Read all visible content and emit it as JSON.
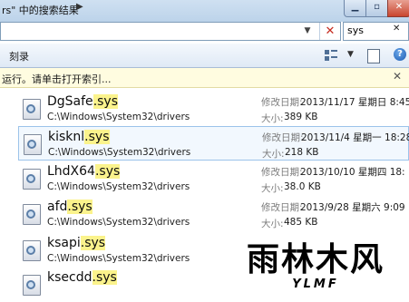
{
  "address": {
    "path_text": "rs\" 中的搜索结果"
  },
  "search": {
    "value": "sys"
  },
  "toolbar": {
    "record_label": "刻录"
  },
  "infobar": {
    "message": "运行。请单击打开索引..."
  },
  "results": [
    {
      "name": "DgSafe",
      "ext": ".sys",
      "path": "C:\\Windows\\System32\\drivers",
      "modified_label": "修改日期:",
      "modified": "2013/11/17 星期日 8:45",
      "size_label": "大小:",
      "size": "389 KB",
      "selected": false
    },
    {
      "name": "kisknl",
      "ext": ".sys",
      "path": "C:\\Windows\\System32\\drivers",
      "modified_label": "修改日期:",
      "modified": "2013/11/4 星期一 18:28",
      "size_label": "大小:",
      "size": "218 KB",
      "selected": true
    },
    {
      "name": "LhdX64",
      "ext": ".sys",
      "path": "C:\\Windows\\System32\\drivers",
      "modified_label": "修改日期:",
      "modified": "2013/10/10 星期四 18:",
      "size_label": "大小:",
      "size": "38.0 KB",
      "selected": false
    },
    {
      "name": "afd",
      "ext": ".sys",
      "path": "C:\\Windows\\System32\\drivers",
      "modified_label": "修改日期:",
      "modified": "2013/9/28 星期六 9:09",
      "size_label": "大小:",
      "size": "485 KB",
      "selected": false
    },
    {
      "name": "ksapi",
      "ext": ".sys",
      "path": "C:\\Windows\\System32\\drivers",
      "modified_label": "",
      "modified": "",
      "size_label": "",
      "size": "",
      "selected": false
    },
    {
      "name": "ksecdd",
      "ext": ".sys",
      "path": "",
      "modified_label": "",
      "modified": "",
      "size_label": "",
      "size": "",
      "selected": false
    }
  ],
  "watermark": {
    "main": "雨林木风",
    "sub": "YLMF"
  },
  "colors": {
    "highlight": "#fbf38c",
    "selection_border": "#9cc3ea",
    "info_bg": "#fffce0"
  }
}
